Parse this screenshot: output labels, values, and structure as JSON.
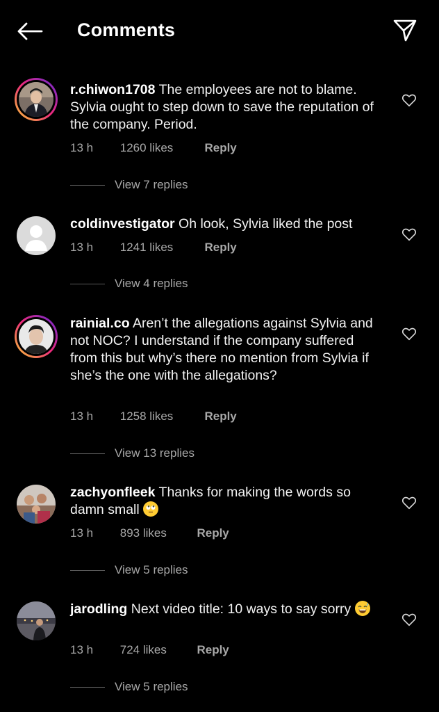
{
  "header": {
    "title": "Comments",
    "back_icon": "arrow-left-icon",
    "send_icon": "paper-plane-icon"
  },
  "comments": [
    {
      "username": "r.chiwon1708",
      "text": "The employees are not to blame. Sylvia ought to step down to save the reputation of the company. Period.",
      "time": "13 h",
      "likes": "1260 likes",
      "reply": "Reply",
      "view_replies": "View 7 replies",
      "avatar": "photo-suit"
    },
    {
      "username": "coldinvestigator",
      "text": "Oh look, Sylvia liked the post",
      "time": "13 h",
      "likes": "1241 likes",
      "reply": "Reply",
      "view_replies": "View 4 replies",
      "avatar": "default-silhouette"
    },
    {
      "username": "rainial.co",
      "text": "Aren’t the allegations against Sylvia and not NOC? I understand if the company suffered from this but why’s there no mention from Sylvia if she’s the one with the allegations?",
      "time": "13 h",
      "likes": "1258 likes",
      "reply": "Reply",
      "view_replies": "View 13 replies",
      "avatar": "photo-portrait"
    },
    {
      "username": "zachyonfleek",
      "text": "Thanks for making the words so damn small",
      "emoji": "rolling-eyes-emoji",
      "time": "13 h",
      "likes": "893 likes",
      "reply": "Reply",
      "view_replies": "View 5 replies",
      "avatar": "photo-group"
    },
    {
      "username": "jarodling",
      "text": "Next video title: 10 ways to say sorry",
      "emoji": "sweat-smile-emoji",
      "time": "13 h",
      "likes": "724 likes",
      "reply": "Reply",
      "view_replies": "View 5 replies",
      "avatar": "photo-city"
    }
  ],
  "colors": {
    "background": "#000000",
    "text": "#f2f2f2",
    "secondary": "#a8a8a8",
    "emoji": "#ffcc33"
  }
}
